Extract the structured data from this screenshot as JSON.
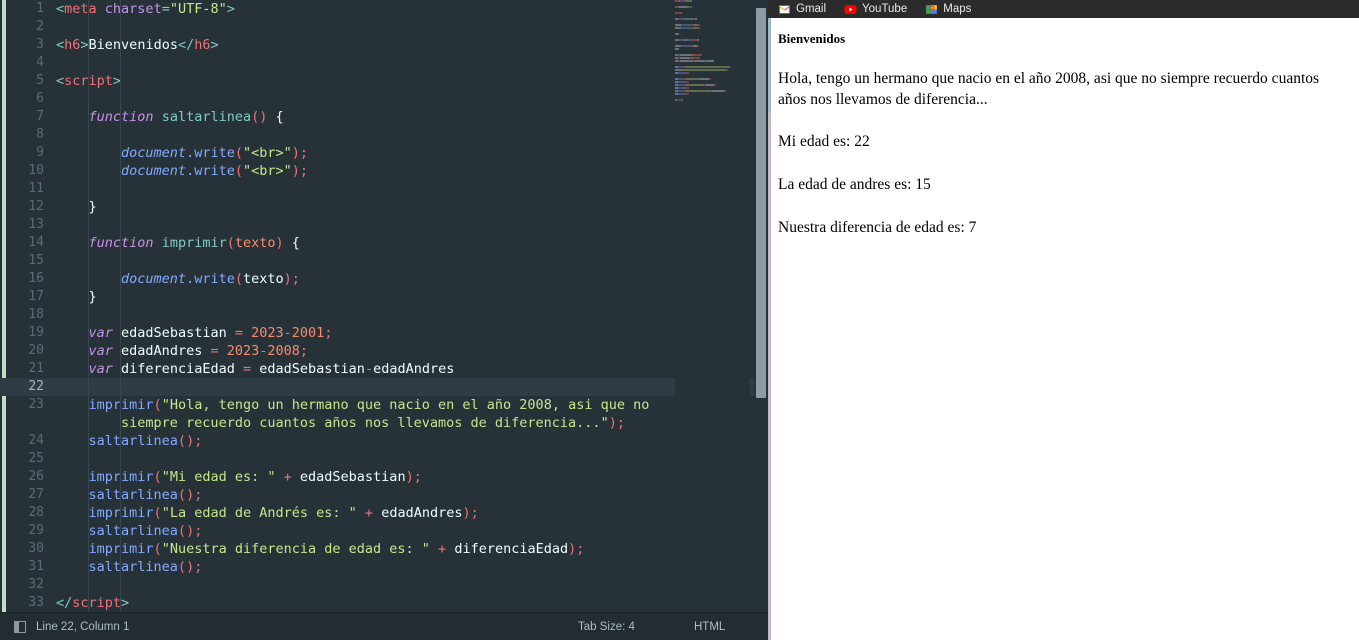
{
  "editor": {
    "status": {
      "cursor": "Line 22, Column 1",
      "tab_size": "Tab Size: 4",
      "language": "HTML",
      "panel_icon": "panel-toggle-icon"
    },
    "lines": [
      {
        "n": "1",
        "tokens": [
          [
            "t-punct",
            "<"
          ],
          [
            "t-tag",
            "meta"
          ],
          [
            "t-plain",
            " "
          ],
          [
            "t-attr",
            "charset"
          ],
          [
            "t-punct",
            "="
          ],
          [
            "t-str",
            "\"UTF-8\""
          ],
          [
            "t-punct",
            ">"
          ]
        ]
      },
      {
        "n": "2",
        "tokens": []
      },
      {
        "n": "3",
        "tokens": [
          [
            "t-punct",
            "<"
          ],
          [
            "t-tag",
            "h6"
          ],
          [
            "t-punct",
            ">"
          ],
          [
            "t-plain",
            "Bienvenidos"
          ],
          [
            "t-punct",
            "</"
          ],
          [
            "t-tag",
            "h6"
          ],
          [
            "t-punct",
            ">"
          ]
        ]
      },
      {
        "n": "4",
        "tokens": []
      },
      {
        "n": "5",
        "tokens": [
          [
            "t-punct",
            "<"
          ],
          [
            "t-tag",
            "script"
          ],
          [
            "t-punct",
            ">"
          ]
        ]
      },
      {
        "n": "6",
        "tokens": []
      },
      {
        "n": "7",
        "tokens": [
          [
            "t-plain",
            "    "
          ],
          [
            "t-kw",
            "function"
          ],
          [
            "t-plain",
            " "
          ],
          [
            "t-fndef",
            "saltarlinea"
          ],
          [
            "t-op",
            "("
          ],
          [
            "t-op",
            ")"
          ],
          [
            "t-plain",
            " "
          ],
          [
            "t-plain",
            "{"
          ]
        ]
      },
      {
        "n": "8",
        "tokens": []
      },
      {
        "n": "9",
        "tokens": [
          [
            "t-plain",
            "        "
          ],
          [
            "t-obj",
            "document"
          ],
          [
            "t-prop",
            ".write"
          ],
          [
            "t-op",
            "("
          ],
          [
            "t-str",
            "\"<br>\""
          ],
          [
            "t-op",
            ")"
          ],
          [
            "t-op",
            ";"
          ]
        ]
      },
      {
        "n": "10",
        "tokens": [
          [
            "t-plain",
            "        "
          ],
          [
            "t-obj",
            "document"
          ],
          [
            "t-prop",
            ".write"
          ],
          [
            "t-op",
            "("
          ],
          [
            "t-str",
            "\"<br>\""
          ],
          [
            "t-op",
            ")"
          ],
          [
            "t-op",
            ";"
          ]
        ]
      },
      {
        "n": "11",
        "tokens": []
      },
      {
        "n": "12",
        "tokens": [
          [
            "t-plain",
            "    }"
          ]
        ]
      },
      {
        "n": "13",
        "tokens": []
      },
      {
        "n": "14",
        "tokens": [
          [
            "t-plain",
            "    "
          ],
          [
            "t-kw",
            "function"
          ],
          [
            "t-plain",
            " "
          ],
          [
            "t-fndef",
            "imprimir"
          ],
          [
            "t-op",
            "("
          ],
          [
            "t-param",
            "texto"
          ],
          [
            "t-op",
            ")"
          ],
          [
            "t-plain",
            " "
          ],
          [
            "t-plain",
            "{"
          ]
        ]
      },
      {
        "n": "15",
        "tokens": []
      },
      {
        "n": "16",
        "tokens": [
          [
            "t-plain",
            "        "
          ],
          [
            "t-obj",
            "document"
          ],
          [
            "t-prop",
            ".write"
          ],
          [
            "t-op",
            "("
          ],
          [
            "t-var",
            "texto"
          ],
          [
            "t-op",
            ")"
          ],
          [
            "t-op",
            ";"
          ]
        ]
      },
      {
        "n": "17",
        "tokens": [
          [
            "t-plain",
            "    }"
          ]
        ]
      },
      {
        "n": "18",
        "tokens": []
      },
      {
        "n": "19",
        "tokens": [
          [
            "t-plain",
            "    "
          ],
          [
            "t-kw",
            "var"
          ],
          [
            "t-plain",
            " "
          ],
          [
            "t-var",
            "edadSebastian"
          ],
          [
            "t-plain",
            " "
          ],
          [
            "t-op",
            "="
          ],
          [
            "t-plain",
            " "
          ],
          [
            "t-num",
            "2023"
          ],
          [
            "t-op",
            "-"
          ],
          [
            "t-num",
            "2001"
          ],
          [
            "t-op",
            ";"
          ]
        ]
      },
      {
        "n": "20",
        "tokens": [
          [
            "t-plain",
            "    "
          ],
          [
            "t-kw",
            "var"
          ],
          [
            "t-plain",
            " "
          ],
          [
            "t-var",
            "edadAndres"
          ],
          [
            "t-plain",
            " "
          ],
          [
            "t-op",
            "="
          ],
          [
            "t-plain",
            " "
          ],
          [
            "t-num",
            "2023"
          ],
          [
            "t-op",
            "-"
          ],
          [
            "t-num",
            "2008"
          ],
          [
            "t-op",
            ";"
          ]
        ]
      },
      {
        "n": "21",
        "tokens": [
          [
            "t-plain",
            "    "
          ],
          [
            "t-kw",
            "var"
          ],
          [
            "t-plain",
            " "
          ],
          [
            "t-var",
            "diferenciaEdad"
          ],
          [
            "t-plain",
            " "
          ],
          [
            "t-op",
            "="
          ],
          [
            "t-plain",
            " "
          ],
          [
            "t-var",
            "edadSebastian"
          ],
          [
            "t-op",
            "-"
          ],
          [
            "t-var",
            "edadAndres"
          ]
        ]
      },
      {
        "n": "22",
        "tokens": [],
        "active": true
      },
      {
        "n": "23",
        "tokens": [
          [
            "t-plain",
            "    "
          ],
          [
            "t-fn",
            "imprimir"
          ],
          [
            "t-op",
            "("
          ],
          [
            "t-str",
            "\"Hola, tengo un hermano que nacio en el año 2008, asi que no"
          ]
        ]
      },
      {
        "n": "",
        "tokens": [
          [
            "t-plain",
            "        "
          ],
          [
            "t-str",
            "siempre recuerdo cuantos años nos llevamos de diferencia...\""
          ],
          [
            "t-op",
            ")"
          ],
          [
            "t-op",
            ";"
          ]
        ]
      },
      {
        "n": "24",
        "tokens": [
          [
            "t-plain",
            "    "
          ],
          [
            "t-fn",
            "saltarlinea"
          ],
          [
            "t-op",
            "("
          ],
          [
            "t-op",
            ")"
          ],
          [
            "t-op",
            ";"
          ]
        ]
      },
      {
        "n": "25",
        "tokens": []
      },
      {
        "n": "26",
        "tokens": [
          [
            "t-plain",
            "    "
          ],
          [
            "t-fn",
            "imprimir"
          ],
          [
            "t-op",
            "("
          ],
          [
            "t-str",
            "\"Mi edad es: \""
          ],
          [
            "t-plain",
            " "
          ],
          [
            "t-op",
            "+"
          ],
          [
            "t-plain",
            " "
          ],
          [
            "t-var",
            "edadSebastian"
          ],
          [
            "t-op",
            ")"
          ],
          [
            "t-op",
            ";"
          ]
        ]
      },
      {
        "n": "27",
        "tokens": [
          [
            "t-plain",
            "    "
          ],
          [
            "t-fn",
            "saltarlinea"
          ],
          [
            "t-op",
            "("
          ],
          [
            "t-op",
            ")"
          ],
          [
            "t-op",
            ";"
          ]
        ]
      },
      {
        "n": "28",
        "tokens": [
          [
            "t-plain",
            "    "
          ],
          [
            "t-fn",
            "imprimir"
          ],
          [
            "t-op",
            "("
          ],
          [
            "t-str",
            "\"La edad de Andrés es: \""
          ],
          [
            "t-plain",
            " "
          ],
          [
            "t-op",
            "+"
          ],
          [
            "t-plain",
            " "
          ],
          [
            "t-var",
            "edadAndres"
          ],
          [
            "t-op",
            ")"
          ],
          [
            "t-op",
            ";"
          ]
        ]
      },
      {
        "n": "29",
        "tokens": [
          [
            "t-plain",
            "    "
          ],
          [
            "t-fn",
            "saltarlinea"
          ],
          [
            "t-op",
            "("
          ],
          [
            "t-op",
            ")"
          ],
          [
            "t-op",
            ";"
          ]
        ]
      },
      {
        "n": "30",
        "tokens": [
          [
            "t-plain",
            "    "
          ],
          [
            "t-fn",
            "imprimir"
          ],
          [
            "t-op",
            "("
          ],
          [
            "t-str",
            "\"Nuestra diferencia de edad es: \""
          ],
          [
            "t-plain",
            " "
          ],
          [
            "t-op",
            "+"
          ],
          [
            "t-plain",
            " "
          ],
          [
            "t-var",
            "diferenciaEdad"
          ],
          [
            "t-op",
            ")"
          ],
          [
            "t-op",
            ";"
          ]
        ]
      },
      {
        "n": "31",
        "tokens": [
          [
            "t-plain",
            "    "
          ],
          [
            "t-fn",
            "saltarlinea"
          ],
          [
            "t-op",
            "("
          ],
          [
            "t-op",
            ")"
          ],
          [
            "t-op",
            ";"
          ]
        ]
      },
      {
        "n": "32",
        "tokens": []
      },
      {
        "n": "33",
        "tokens": [
          [
            "t-punct",
            "</"
          ],
          [
            "t-tag",
            "script"
          ],
          [
            "t-punct",
            ">"
          ]
        ]
      }
    ]
  },
  "browser": {
    "bookmarks": [
      {
        "label": "Gmail",
        "icon": "gmail-icon"
      },
      {
        "label": "YouTube",
        "icon": "youtube-icon"
      },
      {
        "label": "Maps",
        "icon": "maps-icon"
      }
    ],
    "page": {
      "heading": "Bienvenidos",
      "paragraphs": [
        "Hola, tengo un hermano que nacio en el año 2008, asi que no siempre recuerdo cuantos años nos llevamos de diferencia...",
        "Mi edad es: 22",
        "La edad de andres es: 15",
        "Nuestra diferencia de edad es: 7"
      ]
    }
  },
  "colors": {
    "editor_bg": "#263238",
    "active_line": "#2e3c43",
    "gutter_text": "#5b6b73",
    "statusbar_bg": "#222c31",
    "bookmarks_bg": "#2b2b2b",
    "git_indicator": "#c3e0c0",
    "scrollbar_thumb": "#8d9ba3",
    "string": "#c3e88d",
    "keyword": "#c792ea",
    "function": "#82aaff",
    "tag": "#f07178",
    "number": "#f78c6c",
    "punct": "#80cbc4"
  }
}
